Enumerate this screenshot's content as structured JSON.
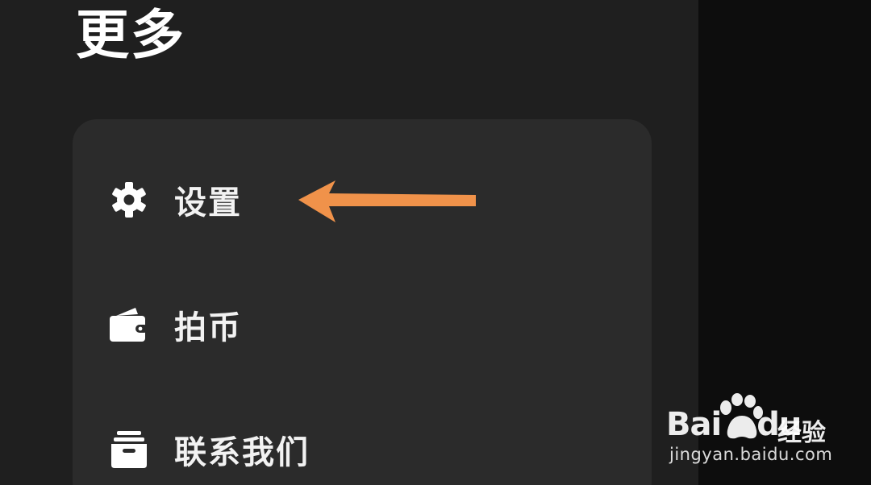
{
  "header": {
    "title": "更多"
  },
  "menu": {
    "items": [
      {
        "label": "设置",
        "icon": "gear-icon"
      },
      {
        "label": "拍币",
        "icon": "wallet-icon"
      },
      {
        "label": "联系我们",
        "icon": "inbox-icon"
      }
    ]
  },
  "annotation": {
    "arrow_color": "#f0924a",
    "points_to": "设置"
  },
  "watermark": {
    "brand": "Bai",
    "brand_suffix": "du",
    "product": "经验",
    "url": "jingyan.baidu.com"
  },
  "colors": {
    "drawer_bg": "#1f1f1f",
    "card_bg": "#2b2b2b",
    "backdrop": "#0d0d0d",
    "text": "#ffffff",
    "accent_arrow": "#f0924a"
  }
}
